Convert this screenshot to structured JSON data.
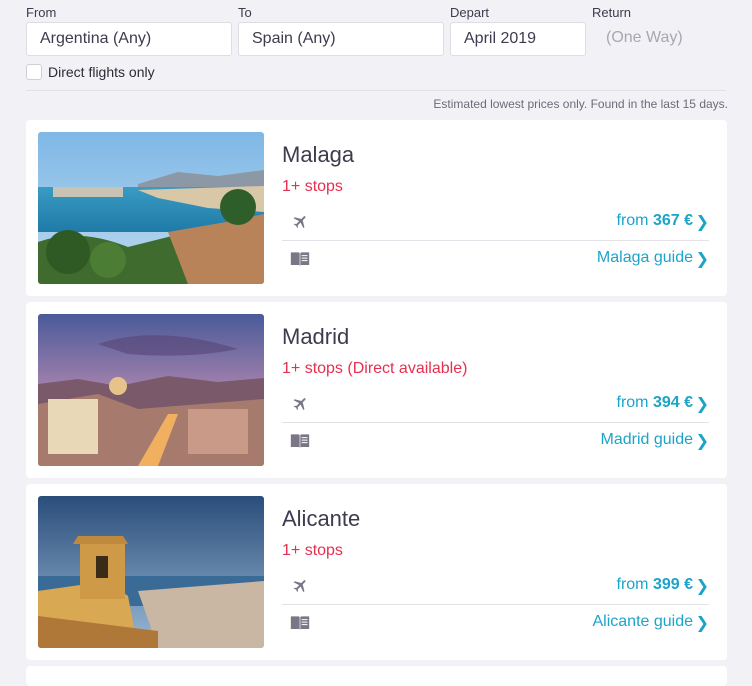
{
  "search": {
    "from_label": "From",
    "from_value": "Argentina (Any)",
    "to_label": "To",
    "to_value": "Spain (Any)",
    "depart_label": "Depart",
    "depart_value": "April 2019",
    "return_label": "Return",
    "return_value": "(One Way)",
    "direct_only_label": "Direct flights only",
    "direct_only_checked": false
  },
  "note": "Estimated lowest prices only. Found in the last 15 days.",
  "destinations": [
    {
      "city": "Malaga",
      "stops": "1+ stops",
      "price_prefix": "from",
      "price": "367 €",
      "guide": "Malaga guide"
    },
    {
      "city": "Madrid",
      "stops": "1+ stops (Direct available)",
      "price_prefix": "from",
      "price": "394 €",
      "guide": "Madrid guide"
    },
    {
      "city": "Alicante",
      "stops": "1+ stops",
      "price_prefix": "from",
      "price": "399 €",
      "guide": "Alicante guide"
    }
  ],
  "icons": {
    "flight": "plane-icon",
    "guide": "book-icon",
    "chevron": "chevron-right-icon"
  },
  "colors": {
    "accent": "#1ca4c8",
    "stops": "#e6304f",
    "background": "#f2f1f6"
  }
}
